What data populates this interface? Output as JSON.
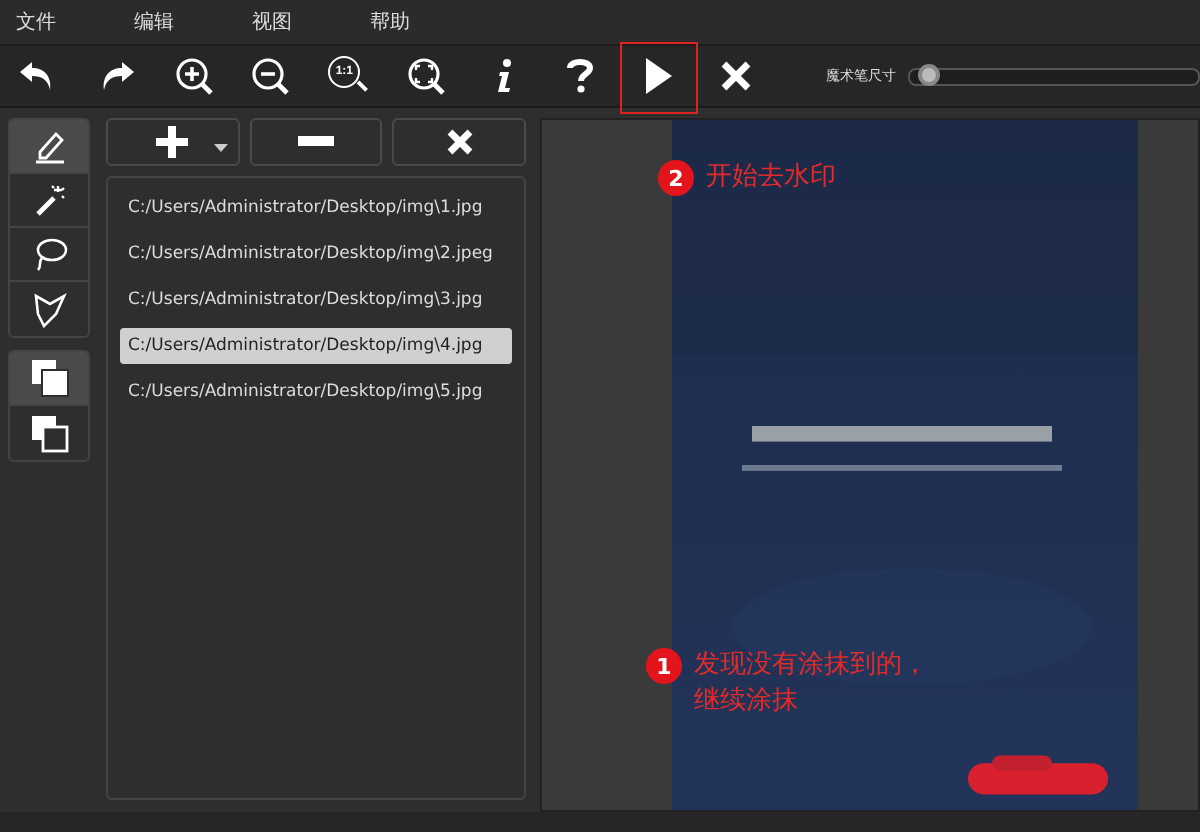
{
  "menu": [
    "文件",
    "编辑",
    "视图",
    "帮助"
  ],
  "toolbar": [
    {
      "kind": "undo"
    },
    {
      "kind": "redo"
    },
    {
      "kind": "zoom-in"
    },
    {
      "kind": "zoom-out"
    },
    {
      "kind": "actual-size",
      "label": "1:1"
    },
    {
      "kind": "fit"
    },
    {
      "kind": "info"
    },
    {
      "kind": "help"
    },
    {
      "kind": "play",
      "highlighted": true
    },
    {
      "kind": "stop"
    }
  ],
  "brush_size": {
    "label": "魔术笔尺寸",
    "level": 0.03
  },
  "tools": [
    {
      "kind": "marker",
      "selected": true
    },
    {
      "kind": "wand",
      "selected": false
    },
    {
      "kind": "lasso",
      "selected": false
    },
    {
      "kind": "polygon",
      "selected": false
    }
  ],
  "modes": [
    {
      "kind": "filled",
      "selected": true
    },
    {
      "kind": "outline",
      "selected": false
    }
  ],
  "list_buttons": [
    {
      "kind": "add"
    },
    {
      "kind": "remove"
    },
    {
      "kind": "clear"
    }
  ],
  "files": [
    {
      "path": "C:/Users/Administrator/Desktop/img\\1.jpg",
      "selected": false
    },
    {
      "path": "C:/Users/Administrator/Desktop/img\\2.jpeg",
      "selected": false
    },
    {
      "path": "C:/Users/Administrator/Desktop/img\\3.jpg",
      "selected": false
    },
    {
      "path": "C:/Users/Administrator/Desktop/img\\4.jpg",
      "selected": true
    },
    {
      "path": "C:/Users/Administrator/Desktop/img\\5.jpg",
      "selected": false
    }
  ],
  "canvas": {
    "kind": "picture"
  },
  "callouts": [
    {
      "number": "2",
      "lines": [
        "开始去水印"
      ]
    },
    {
      "number": "1",
      "lines": [
        "发现没有涂抹到的，",
        "继续涂抹"
      ]
    }
  ]
}
